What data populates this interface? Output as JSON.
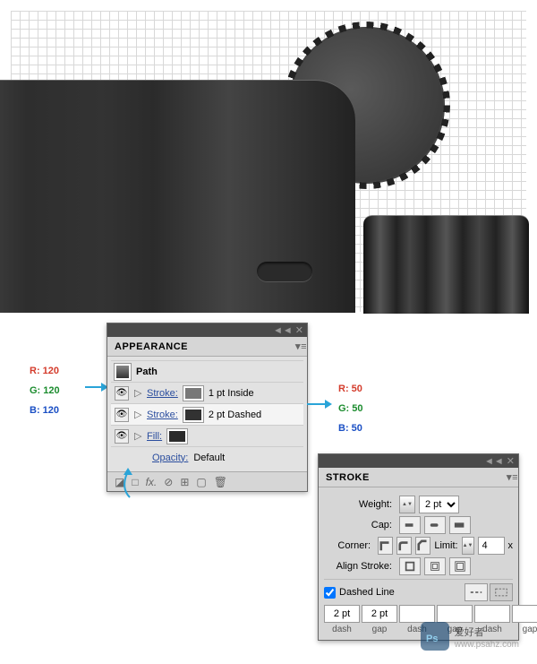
{
  "canvas": {
    "id": "artboard-grid"
  },
  "appearance": {
    "title": "APPEARANCE",
    "path_label": "Path",
    "rows": [
      {
        "kind": "Stroke:",
        "value": "1 pt  Inside",
        "swatch": "#787878"
      },
      {
        "kind": "Stroke:",
        "value": "2 pt Dashed",
        "swatch": "#323232"
      },
      {
        "kind": "Fill:",
        "value": "",
        "swatch": "#2a2a2a"
      }
    ],
    "opacity_label": "Opacity:",
    "opacity_value": "Default",
    "foot": {
      "fx": "fx.",
      "icons": [
        "□",
        "⊘",
        "⊞",
        "🗑"
      ]
    }
  },
  "rgb1": {
    "r": "R: 120",
    "g": "G: 120",
    "b": "B: 120"
  },
  "rgb2": {
    "r": "R: 50",
    "g": "G: 50",
    "b": "B: 50"
  },
  "stroke": {
    "title": "STROKE",
    "weight_label": "Weight:",
    "weight_value": "2 pt",
    "cap_label": "Cap:",
    "corner_label": "Corner:",
    "limit_label": "Limit:",
    "limit_value": "4",
    "limit_suffix": "x",
    "align_label": "Align Stroke:",
    "dashed_label": "Dashed Line",
    "dashed_checked": true,
    "dash": [
      {
        "v": "2 pt",
        "l": "dash"
      },
      {
        "v": "2 pt",
        "l": "gap"
      },
      {
        "v": "",
        "l": "dash"
      },
      {
        "v": "",
        "l": "gap"
      },
      {
        "v": "",
        "l": "dash"
      },
      {
        "v": "",
        "l": "gap"
      }
    ]
  },
  "watermark": {
    "brand": "爱好者",
    "url": "www.psahz.com"
  }
}
